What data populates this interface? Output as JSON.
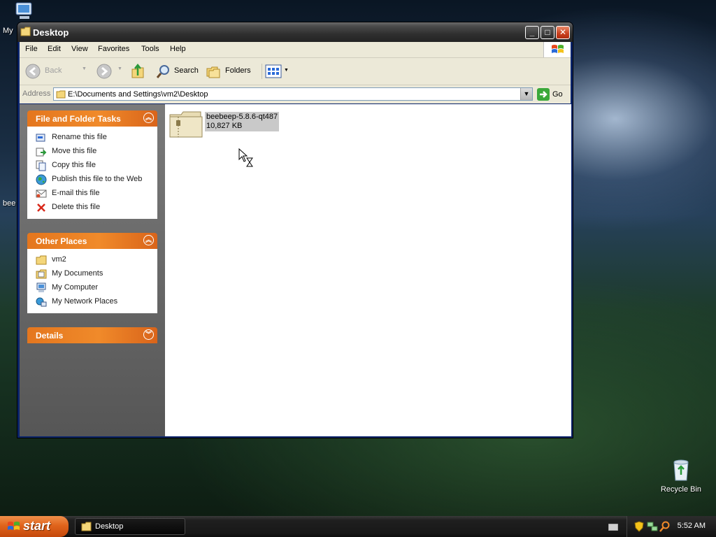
{
  "window": {
    "title": "Desktop",
    "menu": [
      "File",
      "Edit",
      "View",
      "Favorites",
      "Tools",
      "Help"
    ],
    "toolbar": {
      "back_label": "Back",
      "search_label": "Search",
      "folders_label": "Folders"
    },
    "address": {
      "label": "Address",
      "value": "E:\\Documents and Settings\\vm2\\Desktop",
      "go_label": "Go"
    }
  },
  "taskpane": {
    "file_tasks": {
      "title": "File and Folder Tasks",
      "items": [
        {
          "label": "Rename this file",
          "icon": "rename-icon"
        },
        {
          "label": "Move this file",
          "icon": "move-icon"
        },
        {
          "label": "Copy this file",
          "icon": "copy-icon"
        },
        {
          "label": "Publish this file to the Web",
          "icon": "globe-icon"
        },
        {
          "label": "E-mail this file",
          "icon": "email-icon"
        },
        {
          "label": "Delete this file",
          "icon": "delete-icon"
        }
      ]
    },
    "other_places": {
      "title": "Other Places",
      "items": [
        {
          "label": "vm2",
          "icon": "folder-icon"
        },
        {
          "label": "My Documents",
          "icon": "my-documents-icon"
        },
        {
          "label": "My Computer",
          "icon": "my-computer-icon"
        },
        {
          "label": "My Network Places",
          "icon": "network-icon"
        }
      ]
    },
    "details": {
      "title": "Details"
    }
  },
  "content": {
    "files": [
      {
        "name": "beebeep-5.8.6-qt487",
        "size": "10,827 KB",
        "icon": "zip-folder-icon"
      }
    ]
  },
  "desktop": {
    "icons": [
      {
        "label": "My"
      },
      {
        "label": "bee"
      },
      {
        "label": "Recycle Bin"
      }
    ]
  },
  "taskbar": {
    "start_label": "start",
    "tasks": [
      {
        "label": "Desktop"
      }
    ],
    "clock": "5:52 AM"
  },
  "colors": {
    "taskpane_header": "#e4761e",
    "selection": "#c9c9c9",
    "start_button": "#e0641c"
  }
}
